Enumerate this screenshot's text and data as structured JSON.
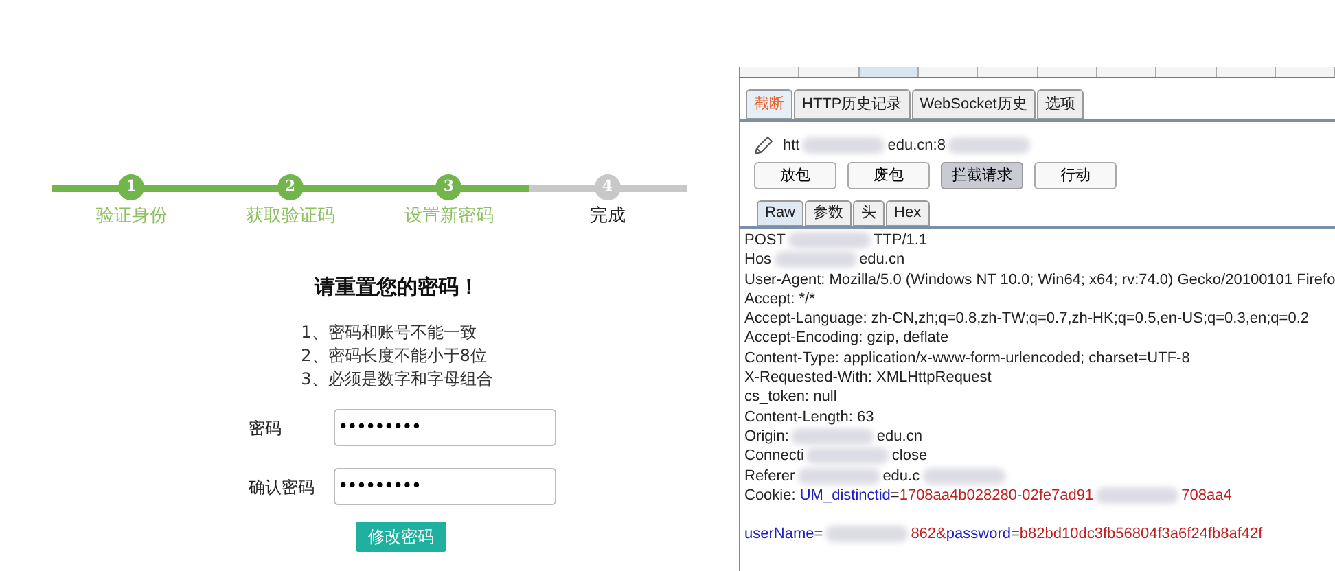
{
  "steps": [
    {
      "number": "1",
      "label": "验证身份",
      "done": true
    },
    {
      "number": "2",
      "label": "获取验证码",
      "done": true
    },
    {
      "number": "3",
      "label": "设置新密码",
      "done": true
    },
    {
      "number": "4",
      "label": "完成",
      "done": false
    }
  ],
  "form": {
    "title": "请重置您的密码！",
    "rules": [
      "1、密码和账号不能一致",
      "2、密码长度不能小于8位",
      "3、必须是数字和字母组合"
    ],
    "fields": [
      {
        "label": "密码",
        "value": "•••••••••"
      },
      {
        "label": "确认密码",
        "value": "•••••••••"
      }
    ],
    "submit": "修改密码"
  },
  "proxy": {
    "tabs": [
      {
        "label": "截断",
        "selected": true
      },
      {
        "label": "HTTP历史记录",
        "selected": false
      },
      {
        "label": "WebSocket历史",
        "selected": false
      },
      {
        "label": "选项",
        "selected": false
      }
    ],
    "url": [
      {
        "kind": "plain",
        "text": "htt"
      },
      {
        "kind": "redacted"
      },
      {
        "kind": "plain",
        "text": "edu.cn:8"
      },
      {
        "kind": "redacted"
      }
    ],
    "buttons": [
      {
        "label": "放包",
        "pressed": false
      },
      {
        "label": "废包",
        "pressed": false
      },
      {
        "label": "拦截请求",
        "pressed": true
      },
      {
        "label": "行动",
        "pressed": false
      }
    ],
    "view_tabs": [
      {
        "label": "Raw",
        "selected": true
      },
      {
        "label": "参数",
        "selected": false
      },
      {
        "label": "头",
        "selected": false
      },
      {
        "label": "Hex",
        "selected": false
      }
    ],
    "request_lines": [
      [
        {
          "kind": "plain",
          "text": "POST"
        },
        {
          "kind": "redacted"
        },
        {
          "kind": "plain",
          "text": "TTP/1.1"
        }
      ],
      [
        {
          "kind": "plain",
          "text": "Hos"
        },
        {
          "kind": "redacted"
        },
        {
          "kind": "plain",
          "text": "edu.cn"
        }
      ],
      [
        {
          "kind": "plain",
          "text": "User-Agent: Mozilla/5.0 (Windows NT 10.0; Win64; x64; rv:74.0) Gecko/20100101 Firefo"
        }
      ],
      [
        {
          "kind": "plain",
          "text": "Accept: */*"
        }
      ],
      [
        {
          "kind": "plain",
          "text": "Accept-Language: zh-CN,zh;q=0.8,zh-TW;q=0.7,zh-HK;q=0.5,en-US;q=0.3,en;q=0.2"
        }
      ],
      [
        {
          "kind": "plain",
          "text": "Accept-Encoding: gzip, deflate"
        }
      ],
      [
        {
          "kind": "plain",
          "text": "Content-Type: application/x-www-form-urlencoded; charset=UTF-8"
        }
      ],
      [
        {
          "kind": "plain",
          "text": "X-Requested-With: XMLHttpRequest"
        }
      ],
      [
        {
          "kind": "plain",
          "text": "cs_token: null"
        }
      ],
      [
        {
          "kind": "plain",
          "text": "Content-Length: 63"
        }
      ],
      [
        {
          "kind": "plain",
          "text": "Origin:"
        },
        {
          "kind": "redacted"
        },
        {
          "kind": "plain",
          "text": "edu.cn"
        }
      ],
      [
        {
          "kind": "plain",
          "text": "Connecti"
        },
        {
          "kind": "redacted"
        },
        {
          "kind": "plain",
          "text": "close"
        }
      ],
      [
        {
          "kind": "plain",
          "text": "Referer"
        },
        {
          "kind": "redacted"
        },
        {
          "kind": "plain",
          "text": "edu.c"
        },
        {
          "kind": "redacted"
        }
      ],
      [
        {
          "kind": "plain",
          "text": "Cookie: "
        },
        {
          "kind": "name",
          "text": "UM_distinctid"
        },
        {
          "kind": "plain",
          "text": "="
        },
        {
          "kind": "value",
          "text": "1708aa4b028280-02fe7ad91"
        },
        {
          "kind": "redacted"
        },
        {
          "kind": "value",
          "text": "708aa4"
        }
      ],
      {
        "gap_before": true,
        "segments": [
          {
            "kind": "name",
            "text": "userName"
          },
          {
            "kind": "plain",
            "text": "="
          },
          {
            "kind": "redacted"
          },
          {
            "kind": "value",
            "text": "862&"
          },
          {
            "kind": "name",
            "text": "password"
          },
          {
            "kind": "plain",
            "text": "="
          },
          {
            "kind": "value",
            "text": "b82bd10dc3fb56804f3a6f24fb8af42f"
          }
        ]
      }
    ]
  }
}
